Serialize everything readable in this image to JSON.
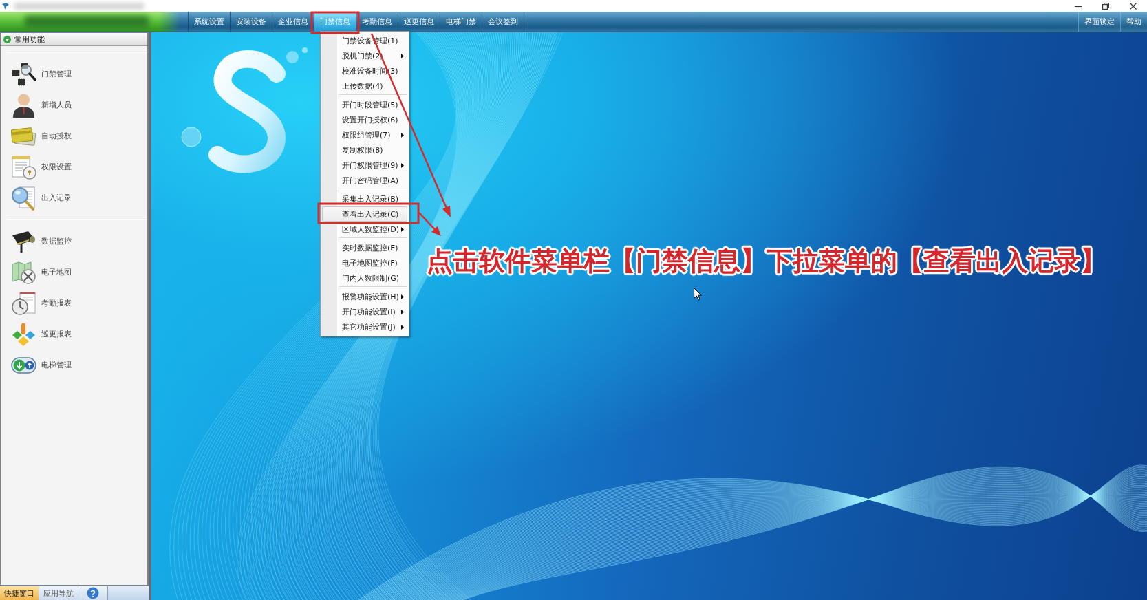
{
  "menu_bar": {
    "items": [
      {
        "label": "系统设置",
        "selected": false
      },
      {
        "label": "安装设备",
        "selected": false
      },
      {
        "label": "企业信息",
        "selected": false
      },
      {
        "label": "门禁信息",
        "selected": true
      },
      {
        "label": "考勤信息",
        "selected": false
      },
      {
        "label": "巡更信息",
        "selected": false
      },
      {
        "label": "电梯门禁",
        "selected": false
      },
      {
        "label": "会议签到",
        "selected": false
      }
    ],
    "right_items": [
      {
        "label": "界面锁定",
        "selected": false
      },
      {
        "label": "帮助",
        "selected": false
      }
    ]
  },
  "sidebar": {
    "header": "常用功能",
    "expanded": true,
    "groups": [
      [
        "门禁管理",
        "新增人员",
        "自动授权",
        "权限设置",
        "出入记录"
      ],
      [
        "数据监控",
        "电子地图",
        "考勤报表",
        "巡更报表",
        "电梯管理"
      ]
    ]
  },
  "bottom_tabs": [
    {
      "kind": "text",
      "label": "快捷窗口",
      "selected": true
    },
    {
      "kind": "text",
      "label": "应用导航",
      "selected": false
    },
    {
      "kind": "help",
      "selected": false
    }
  ],
  "dropdown_menu": {
    "groups": [
      [
        {
          "label": "门禁设备管理(1)",
          "submenu": false,
          "selected": false
        },
        {
          "label": "脱机门禁(2)",
          "submenu": true,
          "selected": false
        },
        {
          "label": "校准设备时间(3)",
          "submenu": false,
          "selected": false
        },
        {
          "label": "上传数据(4)",
          "submenu": false,
          "selected": false
        }
      ],
      [
        {
          "label": "开门时段管理(5)",
          "submenu": false,
          "selected": false
        },
        {
          "label": "设置开门授权(6)",
          "submenu": false,
          "selected": false
        },
        {
          "label": "权限组管理(7)",
          "submenu": true,
          "selected": false
        },
        {
          "label": "复制权限(8)",
          "submenu": false,
          "selected": false
        },
        {
          "label": "开门权限管理(9)",
          "submenu": true,
          "selected": false
        },
        {
          "label": "开门密码管理(A)",
          "submenu": false,
          "selected": false
        }
      ],
      [
        {
          "label": "采集出入记录(B)",
          "submenu": false,
          "selected": false
        },
        {
          "label": "查看出入记录(C)",
          "submenu": false,
          "selected": true
        },
        {
          "label": "区域人数监控(D)",
          "submenu": true,
          "selected": false
        }
      ],
      [
        {
          "label": "实时数据监控(E)",
          "submenu": false,
          "selected": false
        },
        {
          "label": "电子地图监控(F)",
          "submenu": false,
          "selected": false
        },
        {
          "label": "门内人数限制(G)",
          "submenu": false,
          "selected": false
        }
      ],
      [
        {
          "label": "报警功能设置(H)",
          "submenu": true,
          "selected": false
        },
        {
          "label": "开门功能设置(I)",
          "submenu": true,
          "selected": false
        },
        {
          "label": "其它功能设置(J)",
          "submenu": true,
          "selected": false
        }
      ]
    ]
  },
  "annotation": {
    "caption": "点击软件菜单栏【门禁信息】下拉菜单的【查看出入记录】"
  }
}
